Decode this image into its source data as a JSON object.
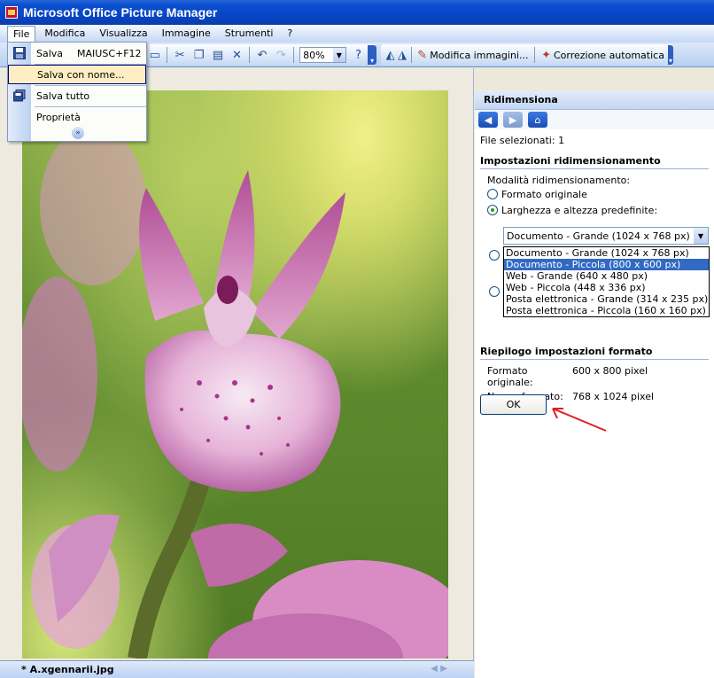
{
  "window": {
    "title": "Microsoft Office Picture Manager"
  },
  "menu": [
    {
      "label": "File",
      "active": true
    },
    {
      "label": "Modifica"
    },
    {
      "label": "Visualizza"
    },
    {
      "label": "Immagine"
    },
    {
      "label": "Strumenti"
    },
    {
      "label": "?"
    }
  ],
  "file_menu": {
    "items": [
      {
        "label": "Salva",
        "shortcut": "MAIUSC+F12",
        "icon": "floppy-disk-icon"
      },
      {
        "label": "Salva con nome...",
        "highlighted": true
      },
      {
        "label": "Salva tutto",
        "icon": "save-all-icon"
      },
      {
        "label": "Proprietà"
      }
    ],
    "expand_icon": "chevron-double-down-icon"
  },
  "toolbar": {
    "zoom": "80%",
    "edit_pictures": "Modifica immagini...",
    "auto_correct": "Correzione automatica"
  },
  "task_pane": {
    "title": "Ridimensiona",
    "selected_files": "File selezionati: 1",
    "resize_settings_title": "Impostazioni ridimensionamento",
    "mode_label": "Modalità ridimensionamento:",
    "option_original": "Formato originale",
    "option_predefined": "Larghezza e altezza predefinite:",
    "select_value": "Documento - Grande (1024 x 768 px)",
    "dropdown_options": [
      "Documento - Grande (1024 x 768 px)",
      "Documento - Piccola (800 x 600 px)",
      "Web - Grande (640 x 480 px)",
      "Web - Piccola (448 x 336 px)",
      "Posta elettronica - Grande (314 x 235 px)",
      "Posta elettronica - Piccola (160 x 160 px)"
    ],
    "summary_title": "Riepilogo impostazioni formato",
    "original_size_label": "Formato originale:",
    "original_size_value": "600 x 800 pixel",
    "new_size_label": "Nuovo formato:",
    "new_size_value": "768 x 1024 pixel",
    "ok_label": "OK"
  },
  "status": {
    "filename": "* A.xgennarii.jpg"
  },
  "colors": {
    "titlebar": "#0644c4",
    "selection": "#316ac5",
    "annotation_arrow": "#e02020"
  }
}
